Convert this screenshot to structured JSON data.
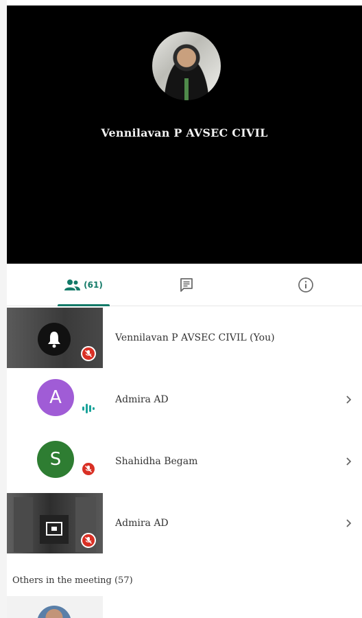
{
  "stage": {
    "speaker_name": "Vennilavan P AVSEC CIVIL"
  },
  "tabs": {
    "people": {
      "icon": "people-icon",
      "count": "(61)"
    },
    "chat": {
      "icon": "chat-icon"
    },
    "info": {
      "icon": "info-icon"
    }
  },
  "participants": [
    {
      "name": "Vennilavan P AVSEC CIVIL (You)",
      "tile": "bell-avatar",
      "muted": true
    },
    {
      "name": "Admira AD",
      "avatar_letter": "A",
      "avatar_color": "#a05cd6",
      "speaking": true
    },
    {
      "name": "Shahidha Begam",
      "avatar_letter": "S",
      "avatar_color": "#2e7d32",
      "muted": true
    },
    {
      "name": "Admira AD",
      "tile": "screen-share",
      "muted": true
    }
  ],
  "others": {
    "label": "Others in the meeting (57)"
  },
  "colors": {
    "accent": "#137a68",
    "mute_red": "#d93025",
    "stage_bg": "#000000"
  }
}
